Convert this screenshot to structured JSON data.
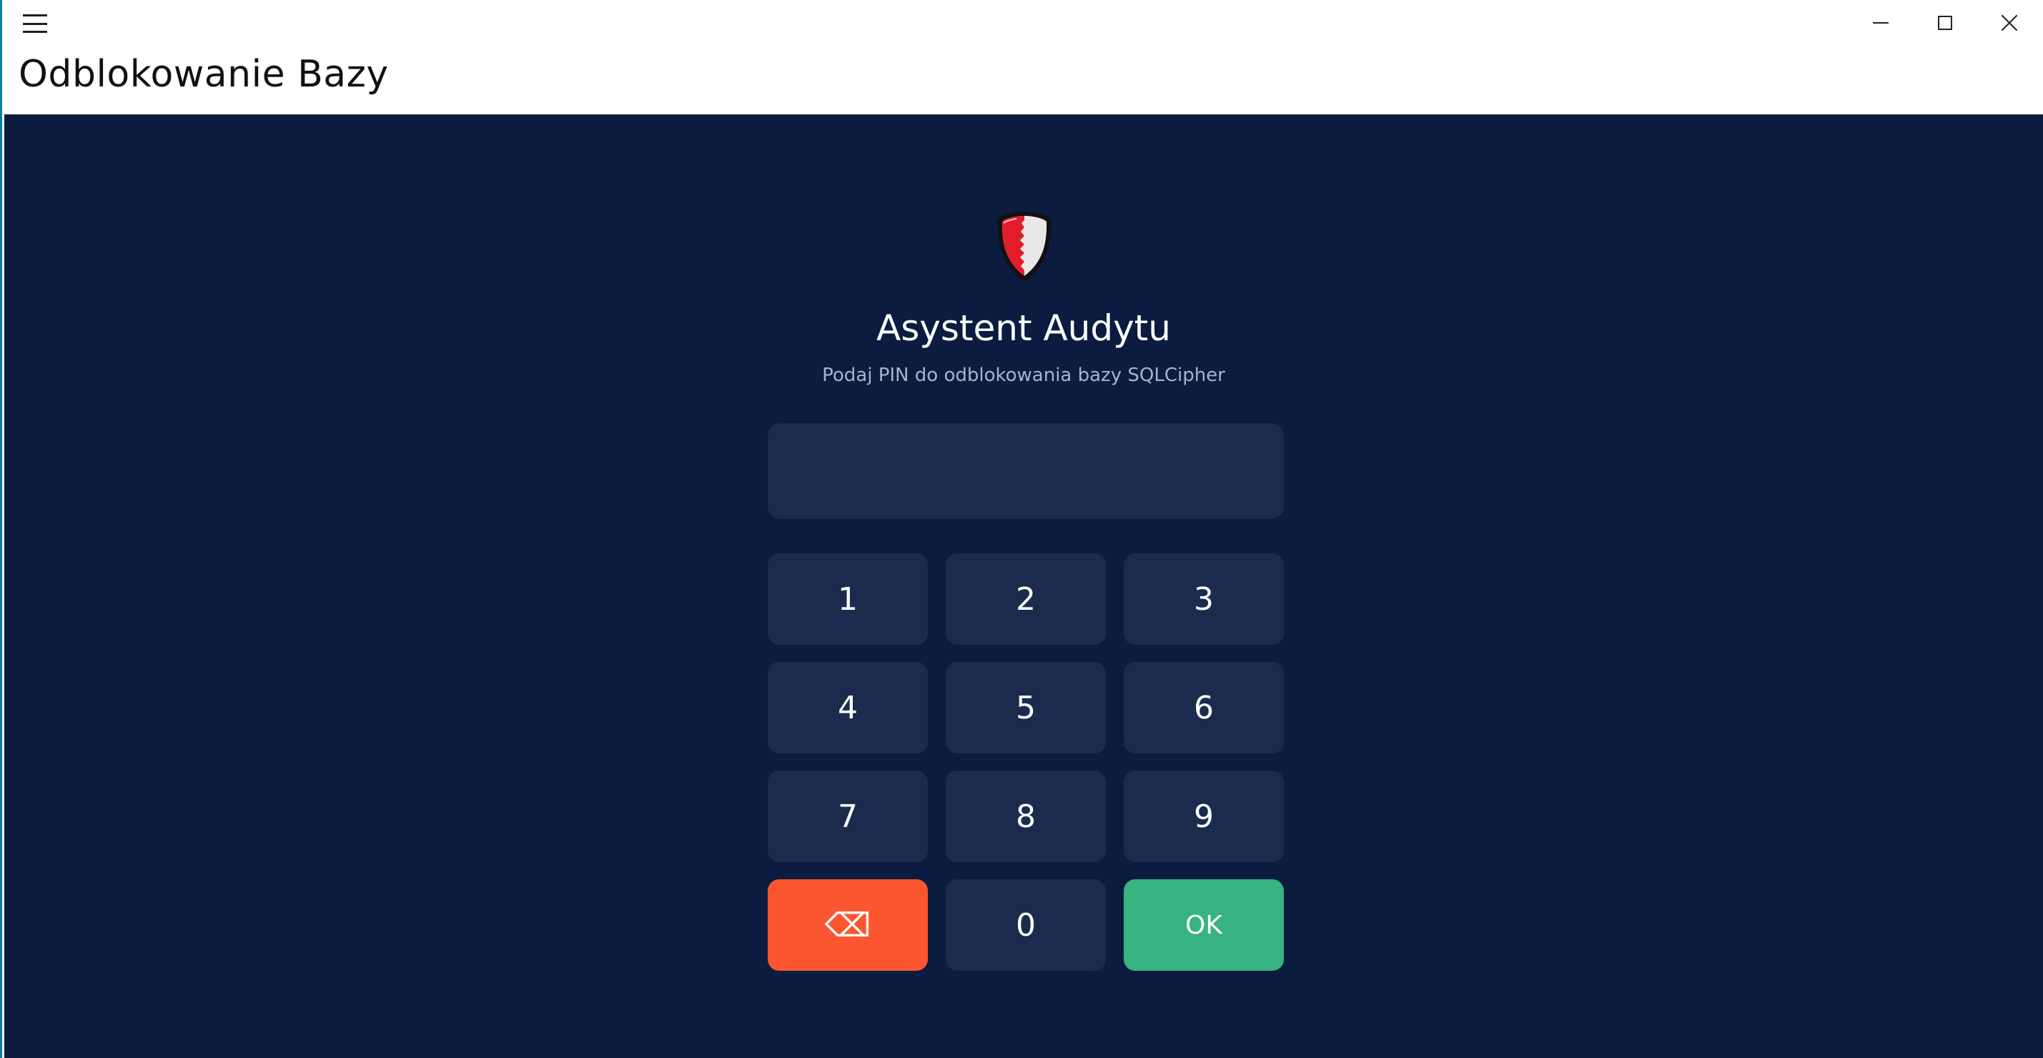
{
  "window": {
    "title": "Odblokowanie Bazy",
    "menu_icon": "hamburger-icon",
    "controls": [
      "minimize-icon",
      "maximize-icon",
      "close-icon"
    ]
  },
  "header": {
    "logo_icon": "shield-icon",
    "app_name": "Asystent Audytu",
    "subtitle": "Podaj PIN do odblokowania bazy SQLCipher"
  },
  "pin_field": {
    "value": "",
    "placeholder": ""
  },
  "keypad": {
    "keys": [
      {
        "label": "1"
      },
      {
        "label": "2"
      },
      {
        "label": "3"
      },
      {
        "label": "4"
      },
      {
        "label": "5"
      },
      {
        "label": "6"
      },
      {
        "label": "7"
      },
      {
        "label": "8"
      },
      {
        "label": "9"
      },
      {
        "label": "⌫",
        "role": "backspace"
      },
      {
        "label": "0"
      },
      {
        "label": "OK",
        "role": "submit"
      }
    ]
  },
  "colors": {
    "background": "#0b1c40",
    "key": "#1a2b4e",
    "backspace": "#fc5630",
    "ok": "#36b37e",
    "window_accent": "#0a7fa8"
  }
}
